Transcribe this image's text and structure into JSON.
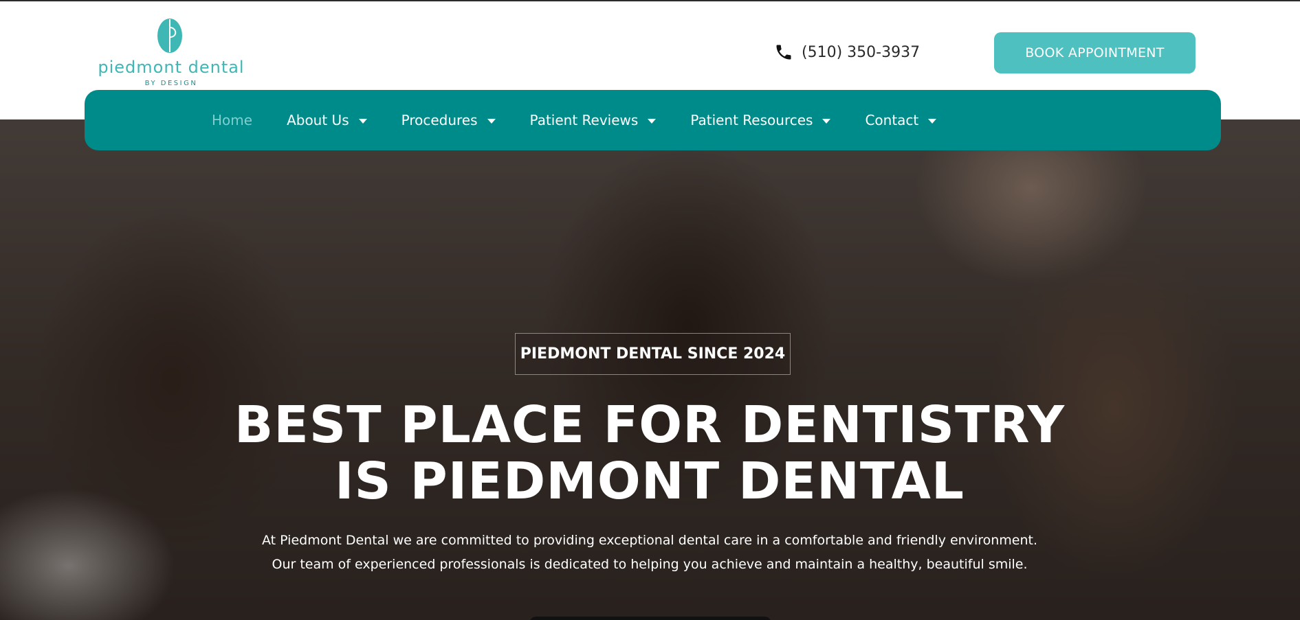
{
  "brand": {
    "name": "piedmont dental",
    "tagline": "BY DESIGN",
    "color": "#3fb7b5"
  },
  "header": {
    "phone_icon": "phone-icon",
    "phone": "(510) 350-3937",
    "book_button": "BOOK APPOINTMENT"
  },
  "nav": {
    "bg_color": "#008b8b",
    "items": [
      {
        "label": "Home",
        "active": true,
        "has_dropdown": false
      },
      {
        "label": "About Us",
        "has_dropdown": true
      },
      {
        "label": "Procedures",
        "has_dropdown": true
      },
      {
        "label": "Patient Reviews",
        "has_dropdown": true
      },
      {
        "label": "Patient Resources",
        "has_dropdown": true
      },
      {
        "label": "Contact",
        "has_dropdown": true
      }
    ]
  },
  "hero": {
    "badge": "PIEDMONT DENTAL SINCE 2024",
    "headline_line1": "BEST PLACE FOR DENTISTRY",
    "headline_line2": "IS PIEDMONT DENTAL",
    "intro": "At Piedmont Dental we are committed to providing exceptional dental care in a comfortable and friendly environment. Our team of experienced professionals is dedicated to helping you achieve and maintain a healthy, beautiful smile."
  }
}
